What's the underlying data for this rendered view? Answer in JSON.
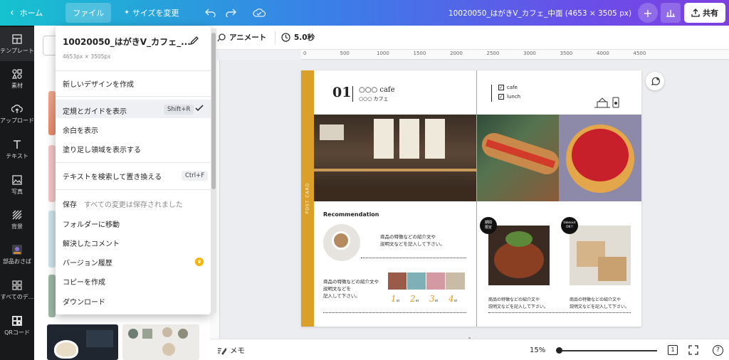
{
  "topbar": {
    "home_label": "ホーム",
    "file_label": "ファイル",
    "resize_label": "サイズを変更",
    "doc_title": "10020050_はがきV_カフェ_中面 (4653 × 3505 px)",
    "share_label": "共有"
  },
  "rail": {
    "items": [
      "テンプレート",
      "素材",
      "アップロード",
      "テキスト",
      "写真",
      "背景",
      "部品おさば",
      "すべてのデ...",
      "QRコード"
    ]
  },
  "editor": {
    "animate_label": "アニメート",
    "duration_label": "5.0秒",
    "ruler_ticks": [
      "0",
      "500",
      "1000",
      "1500",
      "2000",
      "2500",
      "3000",
      "3500",
      "4000",
      "4500"
    ],
    "notes_label": "メモ",
    "zoom_label": "15%",
    "page_count": "1"
  },
  "dropdown": {
    "title": "10020050_はがきV_カフェ_...",
    "dimensions": "4653px × 3505px",
    "new_design": "新しいデザインを作成",
    "show_rulers": "定規とガイドを表示",
    "show_rulers_shortcut": "Shift+R",
    "show_margins": "余白を表示",
    "show_bleed": "塗り足し領域を表示する",
    "find_replace": "テキストを検索して置き換える",
    "find_replace_shortcut": "Ctrl+F",
    "save_label": "保存",
    "save_status": "すべての変更は保存されました",
    "move_folder": "フォルダーに移動",
    "resolved_comments": "解決したコメント",
    "version_history": "バージョン履歴",
    "make_copy": "コピーを作成",
    "download": "ダウンロード"
  },
  "card": {
    "number": "01",
    "brand_en": "○○○ cafe",
    "brand_jp": "○○○ カフェ",
    "check_cafe": "cafe",
    "check_lunch": "lunch",
    "side_text": "POST CARD",
    "recommendation": "Recommendation",
    "desc1_line1": "商品の特徴などの紹介文や",
    "desc1_line2": "説明文などを記入して下さい。",
    "desc2_line1": "商品の特徴などの紹介文や",
    "desc2_line2": "説明文などを",
    "desc2_line3": "記入して下さい。",
    "rank1": "1",
    "rank2": "2",
    "rank3": "3",
    "rank4": "4",
    "rank_suffix": "st",
    "badge1_line1": "期間",
    "badge1_line2": "限定",
    "badge2_line1": "takeout",
    "badge2_line2": "OK!!",
    "desc3_line1": "商品の特徴などの紹介文や",
    "desc3_line2": "説明文などを記入して下さい。",
    "desc4_line1": "商品の特徴などの紹介文や",
    "desc4_line2": "説明文などを記入して下さい。"
  },
  "colors": {
    "accent_gold": "#dba02a",
    "rail_bg": "#18191b",
    "favorite_crown": "#f4b400"
  }
}
